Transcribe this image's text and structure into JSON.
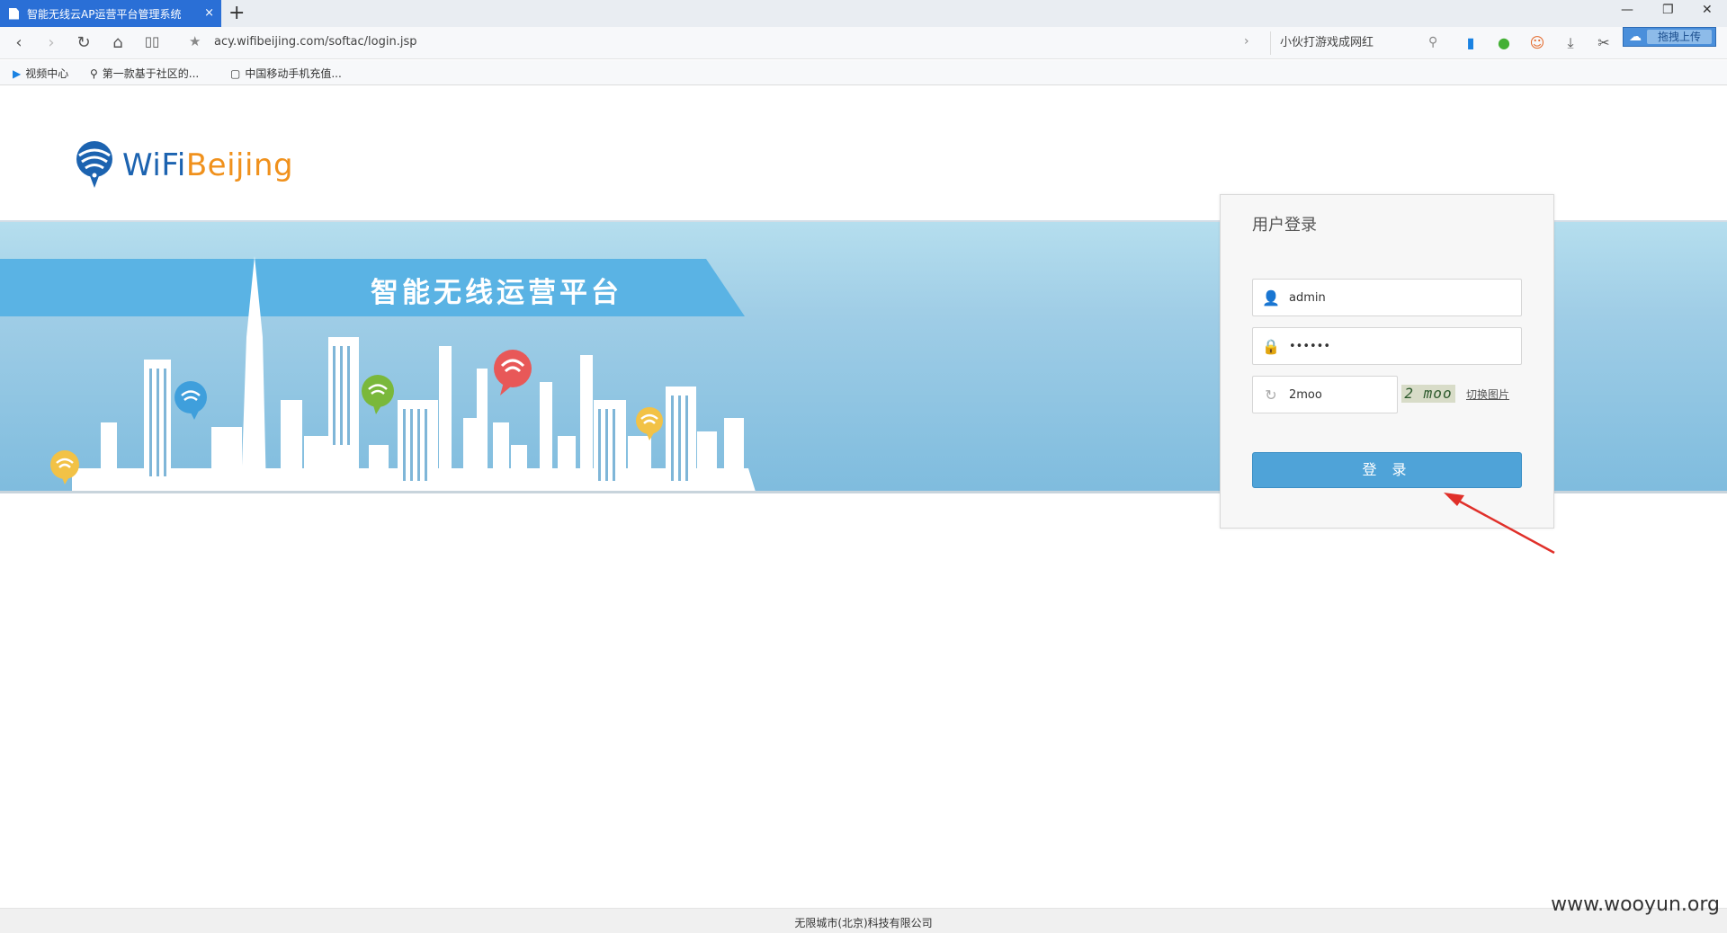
{
  "browser": {
    "tab_title": "智能无线云AP运营平台管理系统",
    "tab_close": "×",
    "new_tab": "+",
    "url": "acy.wifibeijing.com/softac/login.jsp",
    "search_text": "小伙打游戏成网红",
    "upload_badge": "拖拽上传",
    "window_controls": {
      "minimize": "—",
      "restore": "❐",
      "close": "✕"
    },
    "bookmarks": [
      {
        "label": "视频中心",
        "icon": "play-icon"
      },
      {
        "label": "第一款基于社区的...",
        "icon": "search-icon"
      },
      {
        "label": "中国移动手机充值...",
        "icon": "page-icon"
      }
    ]
  },
  "brand": {
    "wifi": "WiFi",
    "beijing": "Beijing"
  },
  "banner": {
    "title": "智能无线运营平台"
  },
  "login": {
    "title": "用户登录",
    "username_value": "admin",
    "password_value": "••••••",
    "captcha_value": "2moo",
    "captcha_image_text": "2 moo",
    "captcha_refresh_link": "切换图片",
    "submit_label": "登 录"
  },
  "footer": {
    "company": "无限城市(北京)科技有限公司"
  },
  "watermark": "www.wooyun.org",
  "colors": {
    "tab_active": "#2a6fd6",
    "brand_blue": "#1c63b0",
    "brand_orange": "#f0911c",
    "banner_ribbon": "#5ab3e4",
    "login_button": "#4fa3d8",
    "arrow": "#e0302a"
  }
}
